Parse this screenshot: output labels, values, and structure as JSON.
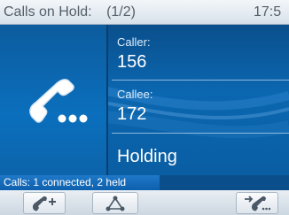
{
  "header": {
    "title": "Calls on Hold:",
    "page_indicator": "(1/2)",
    "time": "17:5"
  },
  "call": {
    "caller_label": "Caller:",
    "caller_number": "156",
    "callee_label": "Callee:",
    "callee_number": "172",
    "state": "Holding",
    "icon": "phone-on-hold-icon"
  },
  "status": {
    "text": "Calls: 1 connected, 2 held"
  },
  "softkeys": [
    {
      "icon": "retrieve-call-icon"
    },
    {
      "icon": "conference-icon"
    },
    {
      "icon": "transfer-call-icon"
    }
  ],
  "colors": {
    "main_background": "#0b67b0",
    "header_background": "#dfe7ef",
    "status_background": "#1f78c8"
  }
}
